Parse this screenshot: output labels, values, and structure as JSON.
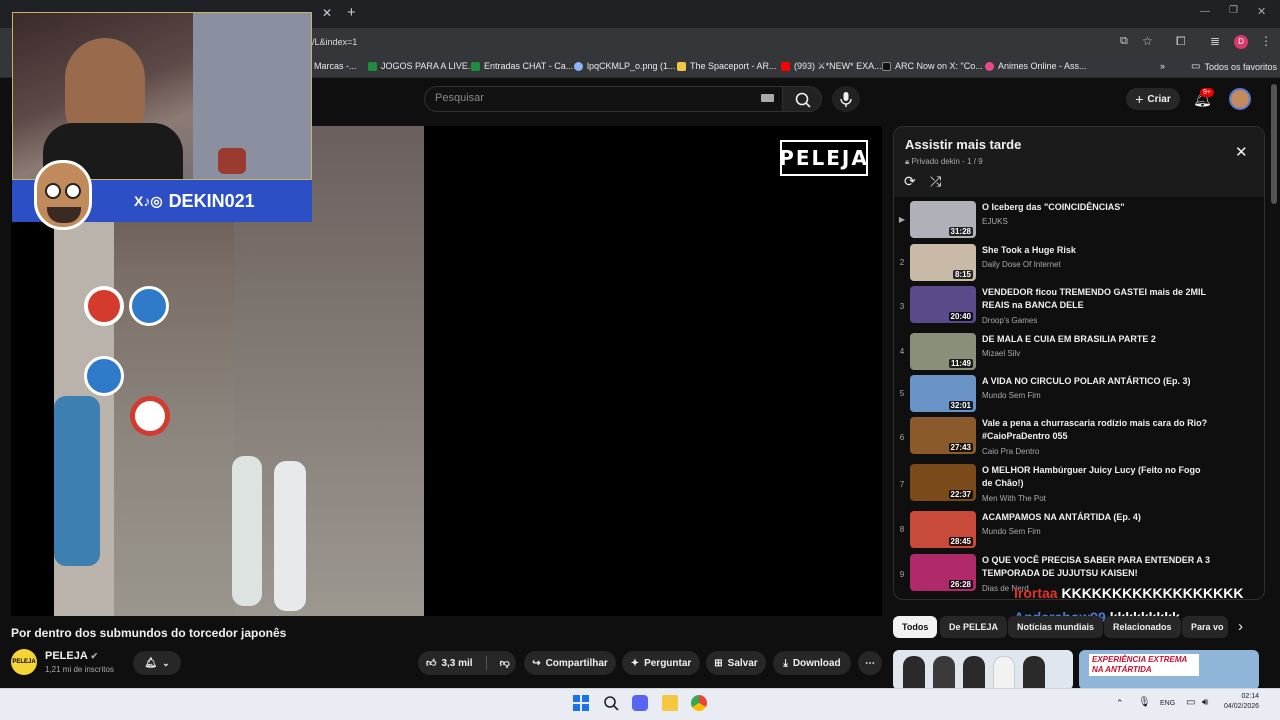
{
  "browser": {
    "address_fragment": "/L&index=1",
    "bookmarks": [
      {
        "label": "Marcas -...",
        "color": "#3c3c3c"
      },
      {
        "label": "JOGOS PARA A LIVE...",
        "color": "#1e8e3e"
      },
      {
        "label": "Entradas CHAT - Ca...",
        "color": "#1e8e3e"
      },
      {
        "label": "lpqCKMLP_o.png (1...",
        "color": "#8ab4f8"
      },
      {
        "label": "The Spaceport - AR...",
        "color": "#f2c744"
      },
      {
        "label": "(993) ⚔*NEW* EXA...",
        "color": "#ff0000"
      },
      {
        "label": "ARC Now on X: \"Co...",
        "color": "#111111"
      },
      {
        "label": "Animes Online - Ass...",
        "color": "#e84b8a"
      }
    ],
    "favorites_label": "Todos os favoritos",
    "profile_initial": "D"
  },
  "youtube": {
    "search_placeholder": "Pesquisar",
    "create_label": "Criar",
    "notifications_badge": "9+"
  },
  "stream_overlay": {
    "handle": "DEKIN021",
    "social_icons": "X♪◎",
    "chat": [
      {
        "user": "lrortaa",
        "message": "KKKKKKKKKKKKKKKKKK",
        "user_color": "#e0342a"
      },
      {
        "user": "Andershow99",
        "message": "kkkkkkkkk",
        "user_color": "#4e7bd6"
      }
    ]
  },
  "video": {
    "watermark": "PELEJA",
    "title": "Por dentro dos submundos do torcedor japonês",
    "channel": "PELEJA",
    "channel_avatar_text": "PELEJA",
    "subscribers": "1,21 mi de inscritos",
    "likes": "3,3 mil",
    "share_label": "Compartilhar",
    "ask_label": "Perguntar",
    "save_label": "Salvar",
    "download_label": "Download"
  },
  "playlist": {
    "title": "Assistir mais tarde",
    "privacy": "Privado",
    "owner_progress": "dekin - 1 / 9",
    "items": [
      {
        "index": "▶",
        "title": "O Iceberg das \"COINCIDÊNCIAS\"",
        "channel": "EJUKS",
        "duration": "31:28",
        "thumb": "#b0b0b8"
      },
      {
        "index": "2",
        "title": "She Took a Huge Risk",
        "channel": "Daily Dose Of Internet",
        "duration": "8:15",
        "thumb": "#c9b9a7"
      },
      {
        "index": "3",
        "title": "VENDEDOR ficou TREMENDO GASTEI mais de 2MIL REAIS na BANCA DELE",
        "channel": "Droop's Games",
        "duration": "20:40",
        "thumb": "#5b4a8a"
      },
      {
        "index": "4",
        "title": "DE MALA E CUIA EM BRASILIA PARTE 2",
        "channel": "Mizael Silv",
        "duration": "11:49",
        "thumb": "#8a8f7a"
      },
      {
        "index": "5",
        "title": "A VIDA NO CIRCULO POLAR ANTÁRTICO (Ep. 3)",
        "channel": "Mundo Sem Fim",
        "duration": "32:01",
        "thumb": "#6a93c8"
      },
      {
        "index": "6",
        "title": "Vale a pena a churrascaria rodízio mais cara do Rio? #CaioPraDentro 055",
        "channel": "Caio Pra Dentro",
        "duration": "27:43",
        "thumb": "#8a5a2a"
      },
      {
        "index": "7",
        "title": "O MELHOR Hambúrguer Juicy Lucy (Feito no Fogo de Chão!)",
        "channel": "Men With The Pot",
        "duration": "22:37",
        "thumb": "#7a4a1a"
      },
      {
        "index": "8",
        "title": "ACAMPAMOS NA ANTÁRTIDA (Ep. 4)",
        "channel": "Mundo Sem Fim",
        "duration": "28:45",
        "thumb": "#c84a3a"
      },
      {
        "index": "9",
        "title": "O QUE VOCÊ PRECISA SABER PARA ENTENDER A 3 TEMPORADA DE JUJUTSU KAISEN!",
        "channel": "Dias de Nerd",
        "duration": "26:28",
        "thumb": "#b02a6a"
      }
    ]
  },
  "chips": [
    "Todos",
    "De PELEJA",
    "Notícias mundiais",
    "Relacionados",
    "Para vo"
  ],
  "recommendations": [
    {
      "caption": "",
      "color": "#dfe6ee"
    },
    {
      "caption": "EXPERIÊNCIA EXTREMA NA ANTÁRTIDA",
      "color": "#8fb6d8"
    }
  ],
  "taskbar": {
    "language": "ENG",
    "time": "02:14",
    "date": "04/02/2026"
  }
}
